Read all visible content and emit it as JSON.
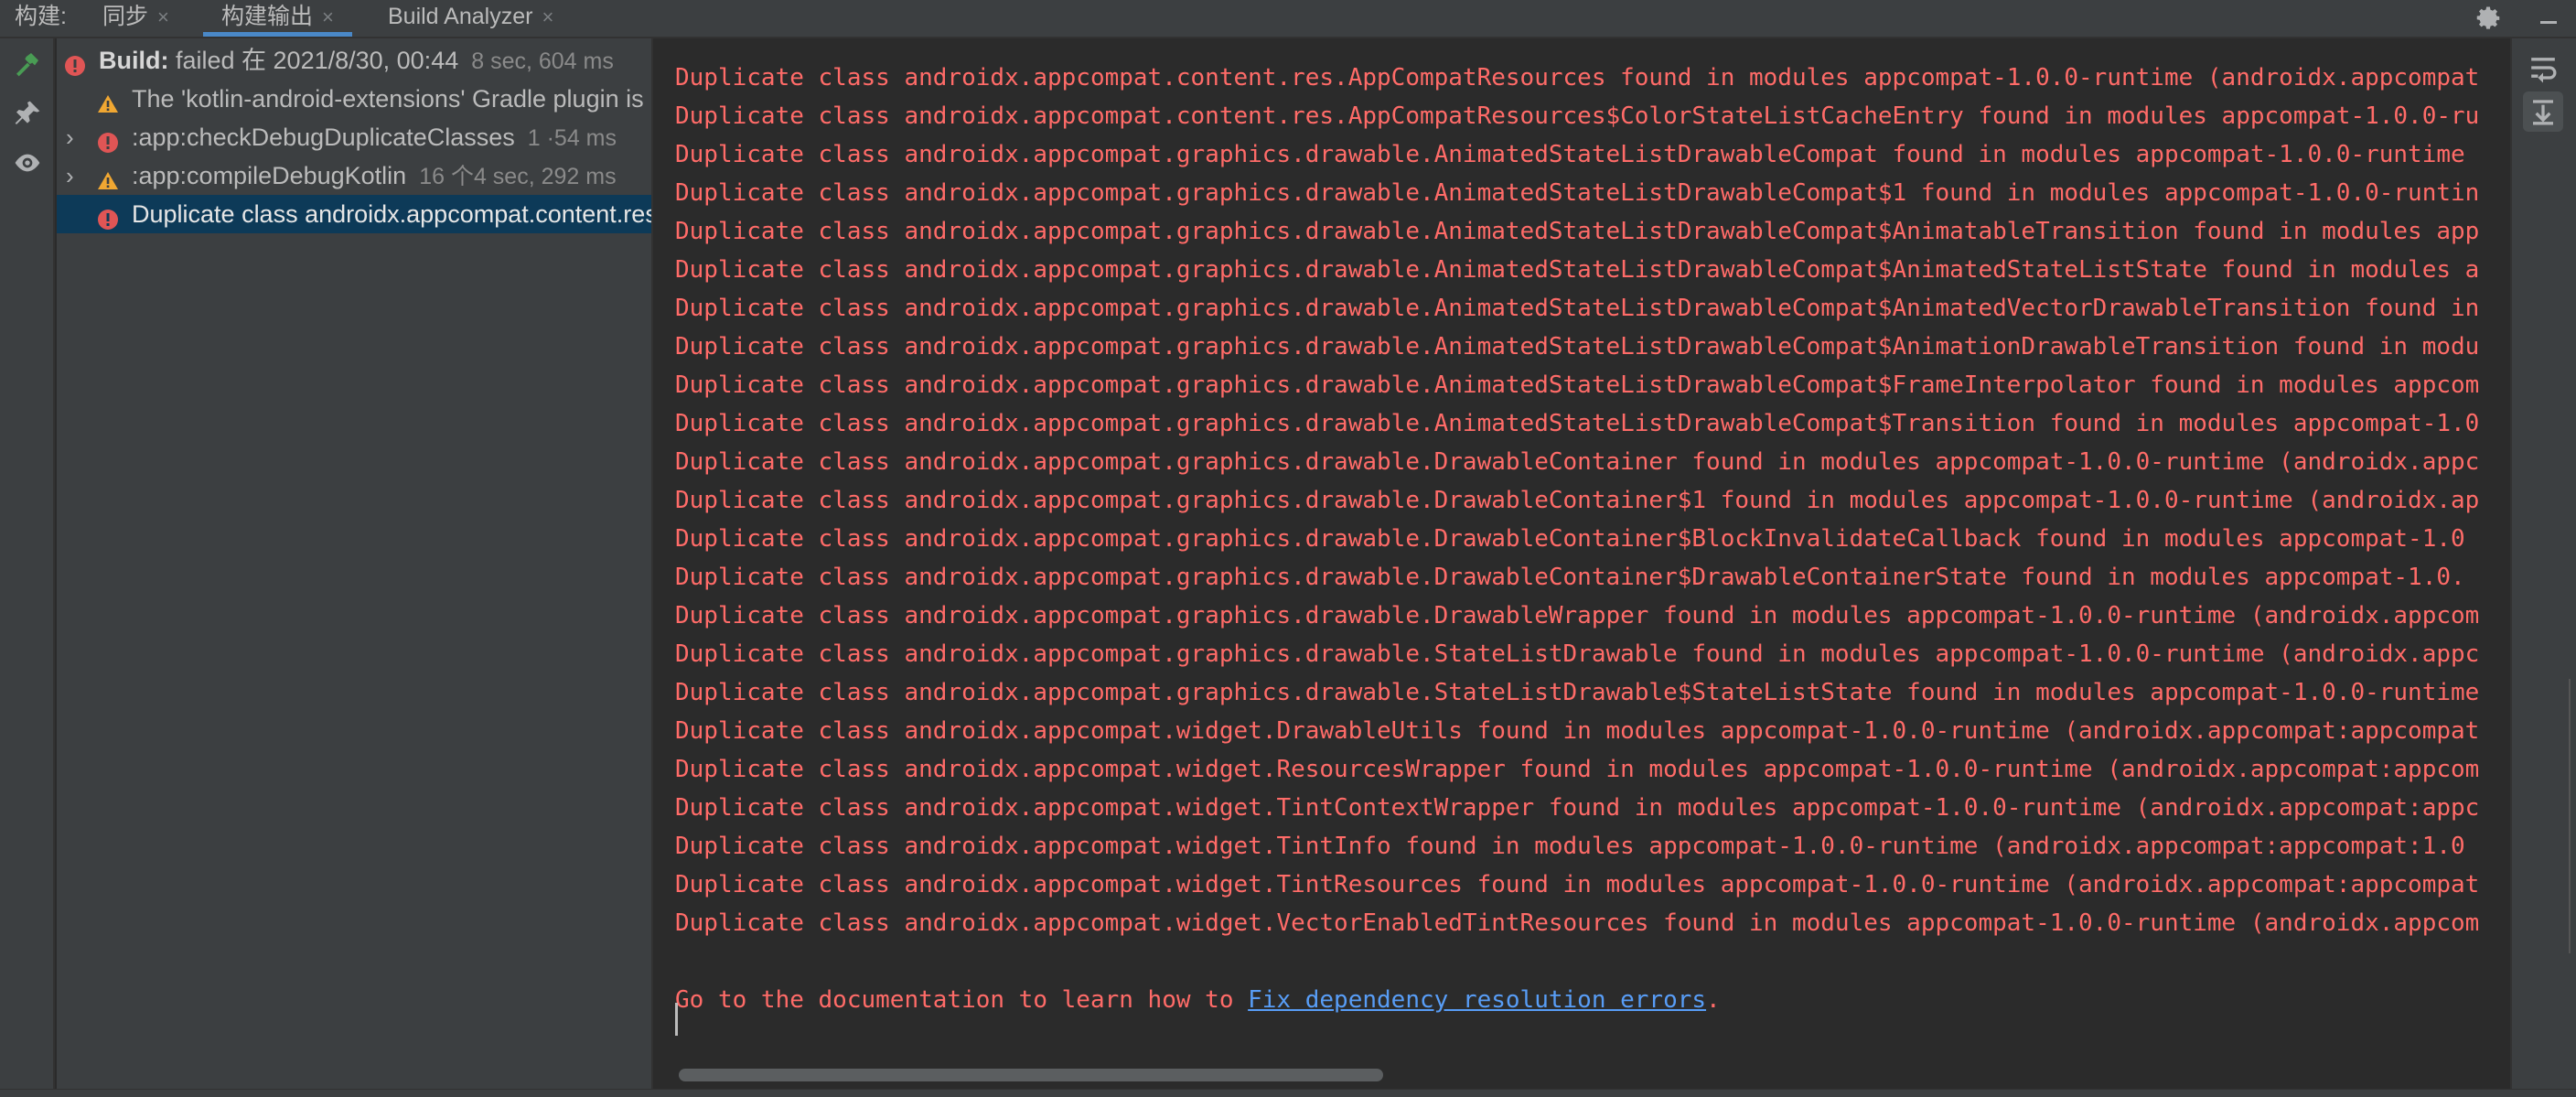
{
  "topbar": {
    "build_label": "构建:",
    "tabs": [
      {
        "label": "同步",
        "close": "×"
      },
      {
        "label": "构建输出",
        "close": "×"
      },
      {
        "label": "Build Analyzer",
        "close": "×"
      }
    ],
    "settings_icon": "gear-icon",
    "hide_icon": "minimize-icon"
  },
  "left_strip": {
    "icons": [
      "hammer-icon",
      "pin-icon",
      "eye-icon"
    ]
  },
  "tree": {
    "items": [
      {
        "icon": "error-icon",
        "prefix": "Build:",
        "text": " failed 在 2021/8/30, 00:44",
        "meta": "8 sec, 604 ms",
        "expanded": true
      },
      {
        "icon": "warning-icon",
        "text": "The 'kotlin-android-extensions' Gradle plugin is deprecated"
      },
      {
        "icon": "error-icon",
        "text": ":app:checkDebugDuplicateClasses",
        "meta": "1 ·54 ms"
      },
      {
        "icon": "warning-icon",
        "text": ":app:compileDebugKotlin",
        "meta": "16 个4 sec, 292 ms"
      },
      {
        "icon": "error-icon",
        "text": "Duplicate class androidx.appcompat.content.res.AppCompatResources found",
        "selected": true
      }
    ]
  },
  "console": {
    "lines": [
      "Duplicate class androidx.appcompat.content.res.AppCompatResources found in modules appcompat-1.0.0-runtime (androidx.appcompat",
      "Duplicate class androidx.appcompat.content.res.AppCompatResources$ColorStateListCacheEntry found in modules appcompat-1.0.0-ru",
      "Duplicate class androidx.appcompat.graphics.drawable.AnimatedStateListDrawableCompat found in modules appcompat-1.0.0-runtime ",
      "Duplicate class androidx.appcompat.graphics.drawable.AnimatedStateListDrawableCompat$1 found in modules appcompat-1.0.0-runtin",
      "Duplicate class androidx.appcompat.graphics.drawable.AnimatedStateListDrawableCompat$AnimatableTransition found in modules app",
      "Duplicate class androidx.appcompat.graphics.drawable.AnimatedStateListDrawableCompat$AnimatedStateListState found in modules a",
      "Duplicate class androidx.appcompat.graphics.drawable.AnimatedStateListDrawableCompat$AnimatedVectorDrawableTransition found in",
      "Duplicate class androidx.appcompat.graphics.drawable.AnimatedStateListDrawableCompat$AnimationDrawableTransition found in modu",
      "Duplicate class androidx.appcompat.graphics.drawable.AnimatedStateListDrawableCompat$FrameInterpolator found in modules appcom",
      "Duplicate class androidx.appcompat.graphics.drawable.AnimatedStateListDrawableCompat$Transition found in modules appcompat-1.0",
      "Duplicate class androidx.appcompat.graphics.drawable.DrawableContainer found in modules appcompat-1.0.0-runtime (androidx.appc",
      "Duplicate class androidx.appcompat.graphics.drawable.DrawableContainer$1 found in modules appcompat-1.0.0-runtime (androidx.ap",
      "Duplicate class androidx.appcompat.graphics.drawable.DrawableContainer$BlockInvalidateCallback found in modules appcompat-1.0",
      "Duplicate class androidx.appcompat.graphics.drawable.DrawableContainer$DrawableContainerState found in modules appcompat-1.0.",
      "Duplicate class androidx.appcompat.graphics.drawable.DrawableWrapper found in modules appcompat-1.0.0-runtime (androidx.appcom",
      "Duplicate class androidx.appcompat.graphics.drawable.StateListDrawable found in modules appcompat-1.0.0-runtime (androidx.appc",
      "Duplicate class androidx.appcompat.graphics.drawable.StateListDrawable$StateListState found in modules appcompat-1.0.0-runtime",
      "Duplicate class androidx.appcompat.widget.DrawableUtils found in modules appcompat-1.0.0-runtime (androidx.appcompat:appcompat",
      "Duplicate class androidx.appcompat.widget.ResourcesWrapper found in modules appcompat-1.0.0-runtime (androidx.appcompat:appcom",
      "Duplicate class androidx.appcompat.widget.TintContextWrapper found in modules appcompat-1.0.0-runtime (androidx.appcompat:appc",
      "Duplicate class androidx.appcompat.widget.TintInfo found in modules appcompat-1.0.0-runtime (androidx.appcompat:appcompat:1.0",
      "Duplicate class androidx.appcompat.widget.TintResources found in modules appcompat-1.0.0-runtime (androidx.appcompat:appcompat",
      "Duplicate class androidx.appcompat.widget.VectorEnabledTintResources found in modules appcompat-1.0.0-runtime (androidx.appcom"
    ],
    "doc_prefix": "Go to the documentation to learn how to ",
    "doc_link": "Fix dependency resolution errors",
    "doc_suffix": "."
  },
  "right_strip": {
    "icons": [
      "soft-wrap-icon",
      "scroll-to-end-icon"
    ]
  },
  "colors": {
    "error_text": "#ff6b68",
    "link": "#589df6",
    "selection": "#0d3a58",
    "error_icon": "#e05555",
    "warning_icon": "#f0a732",
    "build_icon": "#499c54"
  }
}
